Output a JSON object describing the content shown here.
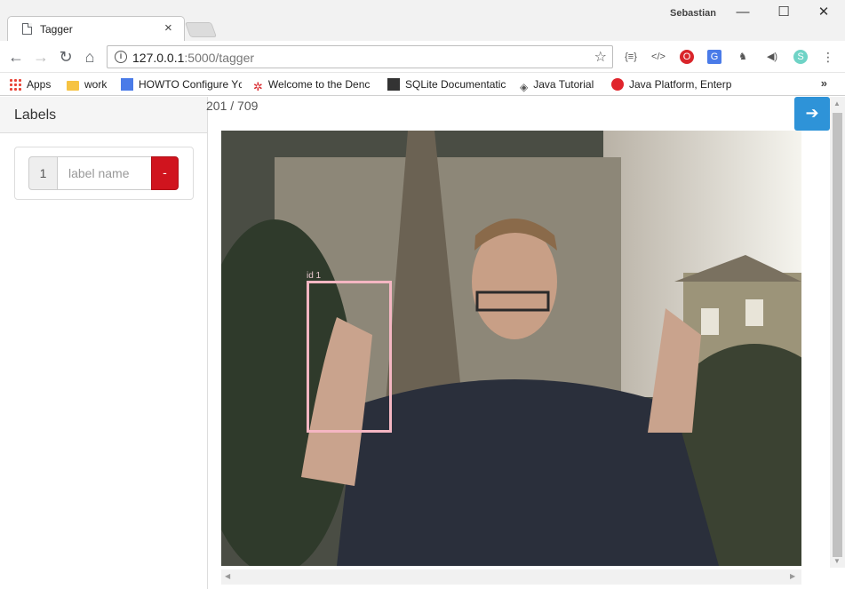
{
  "window": {
    "tab_title": "Tagger",
    "profile_name": "Sebastian"
  },
  "toolbar": {
    "url_host": "127.0.0.1",
    "url_rest": ":5000/tagger"
  },
  "bookmarks": [
    {
      "label": "Apps",
      "icon": "apps-grid-icon"
    },
    {
      "label": "work",
      "icon": "folder-icon"
    },
    {
      "label": "HOWTO Configure Yc",
      "icon": "doc-icon"
    },
    {
      "label": "Welcome to the Denc",
      "icon": "red-dots-icon"
    },
    {
      "label": "SQLite Documentatic",
      "icon": "sqlite-icon"
    },
    {
      "label": "Java Tutorial",
      "icon": "diamond-icon"
    },
    {
      "label": "Java Platform, Enterp",
      "icon": "oracle-icon"
    }
  ],
  "sidebar": {
    "title": "Labels",
    "label_rows": [
      {
        "index": "1",
        "placeholder": "label name",
        "remove_label": "-"
      }
    ]
  },
  "main": {
    "counter": "201 / 709",
    "next_icon": "arrow-right-icon",
    "bbox_label": "id 1"
  },
  "colors": {
    "accent": "#2e93d8",
    "danger": "#d0141e",
    "bbox": "#f4b6c2"
  }
}
